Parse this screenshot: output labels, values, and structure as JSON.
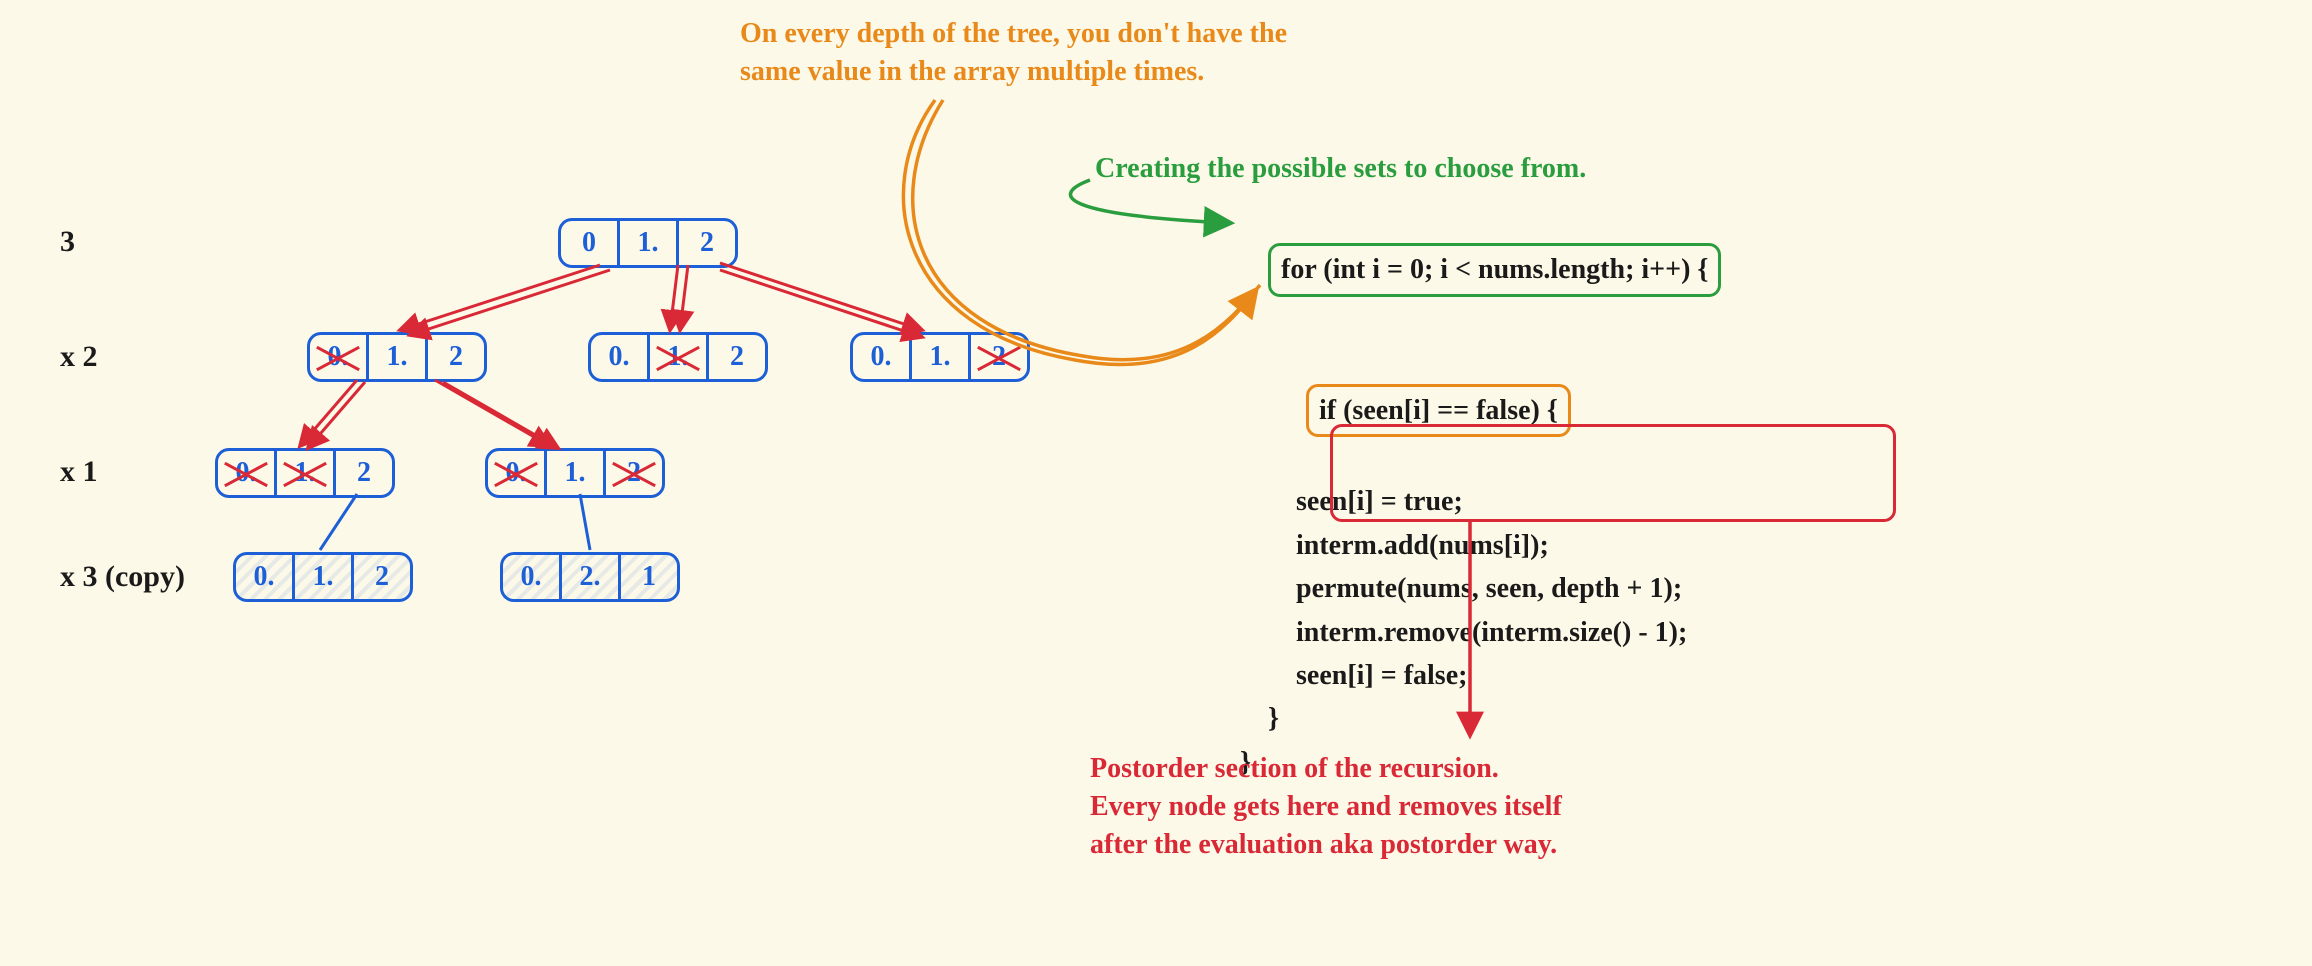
{
  "annotations": {
    "orange_top": "On every depth of the tree, you don't have the\nsame value in the array multiple times.",
    "green_top": "Creating the possible sets to choose from.",
    "red_bottom": "Postorder section of the recursion.\nEvery node gets here and removes itself\nafter the evaluation aka postorder way."
  },
  "row_labels": [
    "3",
    "x 2",
    "x 1",
    "x 3 (copy)"
  ],
  "tree": {
    "root": {
      "cells": [
        "0",
        "1.",
        "2"
      ],
      "strike": []
    },
    "r1": [
      {
        "cells": [
          "0.",
          "1.",
          "2"
        ],
        "strike": [
          0
        ]
      },
      {
        "cells": [
          "0.",
          "1.",
          "2"
        ],
        "strike": [
          1
        ]
      },
      {
        "cells": [
          "0.",
          "1.",
          "2"
        ],
        "strike": [
          2
        ]
      }
    ],
    "r2": [
      {
        "cells": [
          "0.",
          "1.",
          "2"
        ],
        "strike": [
          0,
          1
        ]
      },
      {
        "cells": [
          "0.",
          "1.",
          "2"
        ],
        "strike": [
          0,
          2
        ]
      }
    ],
    "r3_copies": [
      {
        "cells": [
          "0.",
          "1.",
          "2"
        ]
      },
      {
        "cells": [
          "0.",
          "2.",
          "1"
        ]
      }
    ]
  },
  "code": {
    "l1": "for (int i = 0; i < nums.length; i++) {",
    "l2": "if (seen[i] == false) {",
    "l3": "        seen[i] = true;",
    "l4": "        interm.add(nums[i]);",
    "l5": "        permute(nums, seen, depth + 1);",
    "l6": "        interm.remove(interm.size() - 1);",
    "l7": "        seen[i] = false;",
    "l8": "    }",
    "l9": "}"
  },
  "colors": {
    "orange": "#e8891a",
    "green": "#2a9d3f",
    "red": "#d92836",
    "blue": "#1d5fd6",
    "bg": "#fdf9e8"
  }
}
